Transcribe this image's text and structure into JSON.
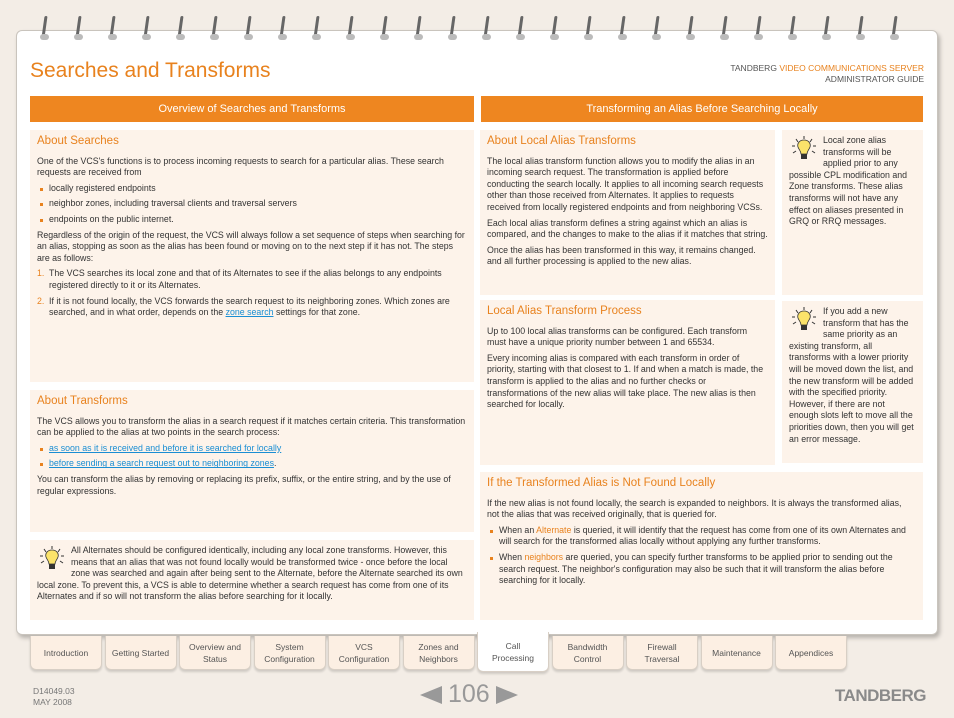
{
  "header": {
    "title": "Searches and Transforms",
    "brand": "TANDBERG",
    "product": "VIDEO COMMUNICATIONS SERVER",
    "guide": "ADMINISTRATOR GUIDE"
  },
  "bars": {
    "left": "Overview of Searches and Transforms",
    "right": "Transforming an Alias Before Searching Locally"
  },
  "about_searches": {
    "heading": "About Searches",
    "intro": "One of the VCS's functions is to process incoming requests to search for a particular alias.  These search requests are received from",
    "bullets": [
      "locally registered endpoints",
      "neighbor zones, including traversal clients and traversal servers",
      "endpoints on the public internet."
    ],
    "para": "Regardless of the origin of the request, the VCS will always follow a set sequence of steps when searching for an alias, stopping as soon as the alias has been found or moving on to the next step if it has not.  The steps are as follows:",
    "steps": [
      {
        "n": "1.",
        "text": "The VCS searches its local zone and that of its Alternates to see if the alias belongs to any endpoints registered directly to it or its Alternates."
      },
      {
        "n": "2.",
        "pre": "If it is not found locally, the VCS forwards the search request to its neighboring zones.  Which zones are searched, and in what order, depends on the ",
        "link": "zone search",
        "post": " settings for that zone."
      }
    ]
  },
  "about_transforms": {
    "heading": "About Transforms",
    "intro": "The VCS allows you to transform the alias in a search request if it matches certain criteria.  This transformation can be applied to the alias at two points in the search process:",
    "links": [
      "as soon as it is received and before it is searched for locally",
      "before sending a search request out to neighboring zones"
    ],
    "para": "You can transform the alias by removing or replacing its prefix, suffix, or the entire string, and by the use of regular expressions."
  },
  "tip_alternates": "All Alternates should be configured identically, including any local zone transforms.  However, this means that an alias that was not found locally would be transformed twice - once before the local zone was searched and again after being sent to the Alternate, before the Alternate searched its own local zone.  To prevent this, a VCS is able to determine whether a search request has come from one of its Alternates and if so will not transform the alias before searching for it locally.",
  "local_alias": {
    "heading": "About Local Alias Transforms",
    "paras": [
      "The local alias transform function allows you to modify the alias in an incoming search request.  The transformation is applied before conducting the search locally.  It applies to all incoming search requests other than those received from Alternates.  It applies to requests received from locally registered endpoints and from neighboring VCSs.",
      "Each local alias transform defines a string against which an alias is compared, and the changes to make to the alias if it matches that string.",
      "Once the alias has been transformed in this way, it remains changed. and all further processing is applied to the new alias."
    ]
  },
  "tip_local": "Local zone alias transforms will be applied prior to any possible CPL modification and Zone transforms. These alias transforms will not have any effect on aliases presented in GRQ or RRQ messages.",
  "process": {
    "heading": "Local Alias Transform Process",
    "paras": [
      "Up to 100 local alias transforms can be configured. Each transform must have a unique priority number between 1 and 65534.",
      "Every incoming alias is compared with each transform in order of priority, starting with that closest to 1.  If and when a match is made, the transform is applied to the alias and no further checks or transformations of the new alias will take place.  The new alias is then searched for locally."
    ]
  },
  "tip_priority": "If you add a new transform that has the same priority as an existing transform, all transforms with a lower priority will be moved down the list, and the new transform will be added with the specified priority. However, if there are not enough slots left to move all the priorities down, then you will get an error message.",
  "not_found": {
    "heading": "If the Transformed Alias is Not Found Locally",
    "intro": "If the new alias is not found locally, the search is expanded to neighbors.  It is always the transformed alias, not the alias that was received originally, that is queried for.",
    "b1_pre": "When an ",
    "b1_hl": "Alternate",
    "b1_post": " is queried, it will identify that the request has come from one of its own Alternates and will search for the transformed alias locally without applying any further transforms.",
    "b2_pre": "When ",
    "b2_hl": "neighbors",
    "b2_post": " are queried, you can specify further transforms to be applied prior to sending out the search request.  The neighbor's configuration may also be such that it will transform the alias before searching for it locally."
  },
  "tabs": [
    {
      "l1": "Introduction",
      "l2": ""
    },
    {
      "l1": "Getting Started",
      "l2": ""
    },
    {
      "l1": "Overview and",
      "l2": "Status"
    },
    {
      "l1": "System",
      "l2": "Configuration"
    },
    {
      "l1": "VCS",
      "l2": "Configuration"
    },
    {
      "l1": "Zones and",
      "l2": "Neighbors"
    },
    {
      "l1": "Call",
      "l2": "Processing"
    },
    {
      "l1": "Bandwidth",
      "l2": "Control"
    },
    {
      "l1": "Firewall",
      "l2": "Traversal"
    },
    {
      "l1": "Maintenance",
      "l2": ""
    },
    {
      "l1": "Appendices",
      "l2": ""
    }
  ],
  "active_tab": "Call Processing",
  "footer": {
    "doc": "D14049.03",
    "date": "MAY 2008",
    "page": "106",
    "logo": "TANDBERG"
  },
  "colors": {
    "accent": "#e8821e",
    "bar": "#ee8620",
    "panel": "#fdf3ea",
    "link": "#1a8ed3"
  }
}
